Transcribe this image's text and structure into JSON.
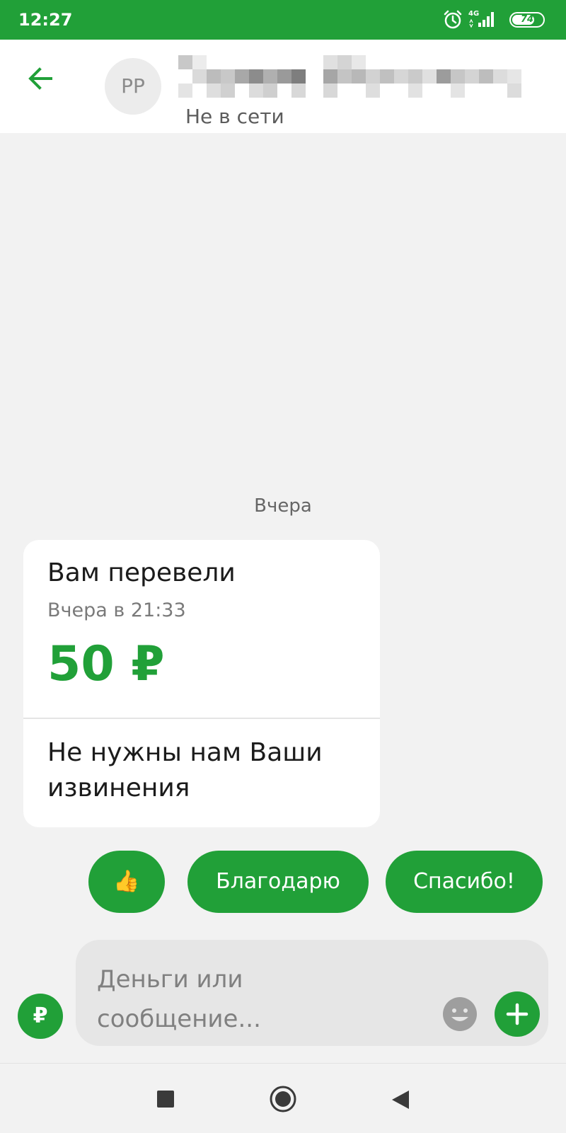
{
  "status_bar": {
    "time": "12:27",
    "network": "4G",
    "battery": "74",
    "battery_level_percent": 74,
    "icons": [
      "alarm-icon",
      "signal-icon",
      "battery-icon"
    ]
  },
  "header": {
    "avatar_initials": "PP",
    "contact_name": "",
    "contact_status": "Не в сети"
  },
  "chat": {
    "date_separator": "Вчера",
    "transfer_card": {
      "title": "Вам перевели",
      "time": "Вчера в 21:33",
      "amount": "50 ₽",
      "message": "Не нужны нам Ваши извинения"
    }
  },
  "quick_replies": {
    "like_icon": "👍",
    "reply_1": "Благодарю",
    "reply_2": "Спасибо!"
  },
  "composer": {
    "currency_symbol": "₽",
    "placeholder": "Деньги или сообщение..."
  },
  "colors": {
    "accent": "#21a038",
    "background": "#f2f2f2"
  }
}
